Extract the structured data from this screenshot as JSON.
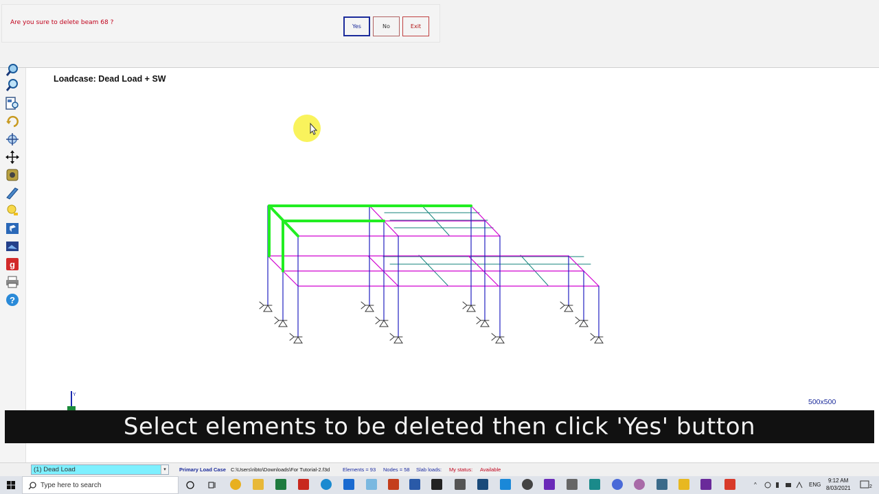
{
  "dialog": {
    "message": "Are you sure to delete beam 68 ?",
    "yes_label": "Yes",
    "no_label": "No",
    "exit_label": "Exit"
  },
  "canvas": {
    "loadcase_label": "Loadcase: Dead Load + SW",
    "axis_y_label": "Y",
    "view_size": "500x500"
  },
  "caption": "Select elements to be deleted then click 'Yes' button",
  "statusbar": {
    "load_case_selected": "(1) Dead Load",
    "primary_load_case": "Primary Load Case",
    "file_path": "C:\\Users\\ribto\\Downloads\\For Tutorial-2.f3d",
    "elements": "Elements = 93",
    "nodes": "Nodes = 58",
    "slab_loads": "Slab loads:",
    "my_status": "My status:",
    "status_value": "Available"
  },
  "taskbar": {
    "search_placeholder": "Type here to search",
    "lang": "ENG",
    "time": "9:12 AM",
    "date": "8/03/2021",
    "notification_count": "2"
  },
  "colors": {
    "dialog_text": "#c0001a",
    "selected_member": "#22ee22",
    "beam_magenta": "#d000d0",
    "column_blue": "#2020c0",
    "slab_line": "#10807a"
  },
  "toolbar_icons": [
    "zoom-window-icon",
    "zoom-icon",
    "zoom-extents-icon",
    "rotate-icon",
    "pan-icon",
    "move-icon",
    "settings-icon",
    "beam-tool-icon",
    "light-icon",
    "3d-view-icon",
    "screenshot-icon",
    "google-icon",
    "print-icon",
    "help-icon"
  ]
}
